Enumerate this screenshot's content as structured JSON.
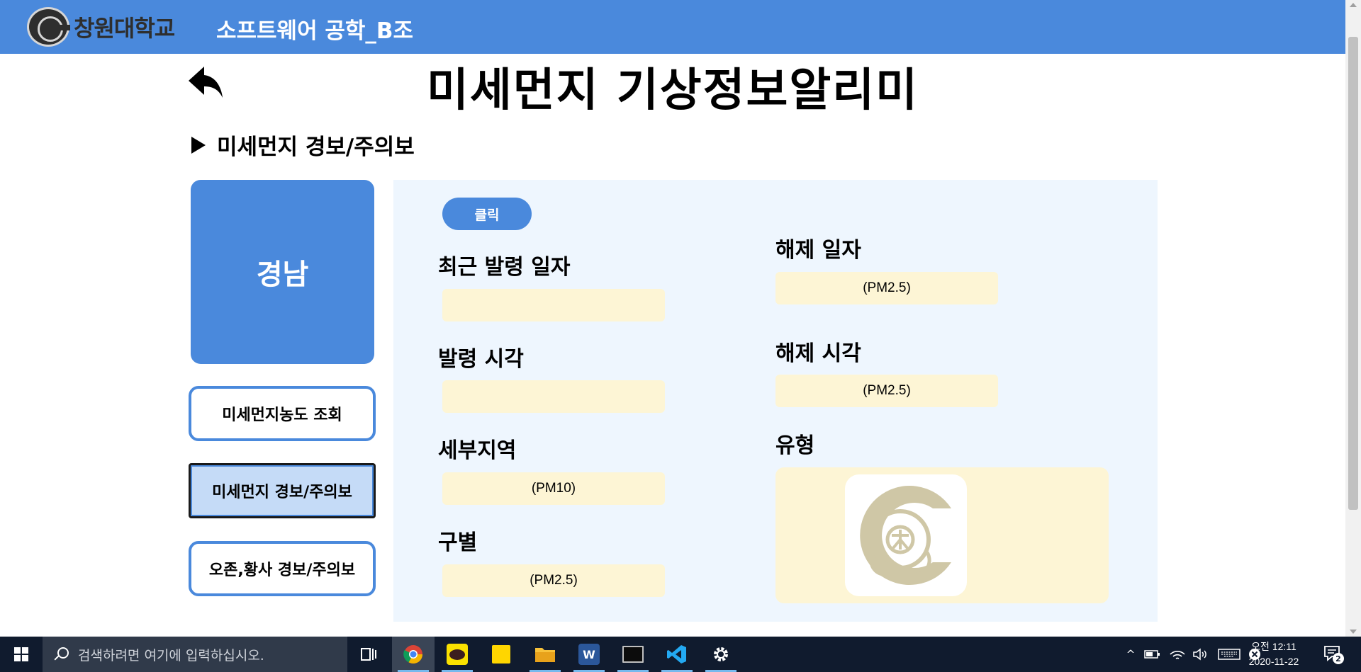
{
  "header": {
    "logo_text": "창원대학교",
    "app_title": "소프트웨어 공학_B조"
  },
  "page": {
    "title": "미세먼지 기상정보알리미",
    "section_title": "미세먼지 경보/주의보"
  },
  "sidebar": {
    "region": "경남",
    "items": [
      {
        "label": "미세먼지농도 조회",
        "active": false
      },
      {
        "label": "미세먼지 경보/주의보",
        "active": true
      },
      {
        "label": "오존,황사 경보/주의보",
        "active": false
      }
    ]
  },
  "panel": {
    "click_button": "클릭",
    "issue_date_label": "최근 발령 일자",
    "issue_date_value": "",
    "issue_time_label": "발령 시각",
    "issue_time_value": "",
    "district_label": "세부지역",
    "district_value": "(PM10)",
    "category_label": "구별",
    "category_value": "(PM2.5)",
    "release_date_label": "해제 일자",
    "release_date_value": "(PM2.5)",
    "release_time_label": "해제 시각",
    "release_time_value": "(PM2.5)",
    "type_label": "유형"
  },
  "taskbar": {
    "search_placeholder": "검색하려면 여기에 입력하십시오.",
    "clock_time": "오전 12:11",
    "clock_date": "2020-11-22",
    "notification_count": "2"
  },
  "colors": {
    "brand_blue": "#4a89dc",
    "panel_bg": "#eef6fe",
    "field_bg": "#fdf5d5",
    "active_nav_bg": "#c5dbf7",
    "taskbar_bg": "#101b2e"
  }
}
